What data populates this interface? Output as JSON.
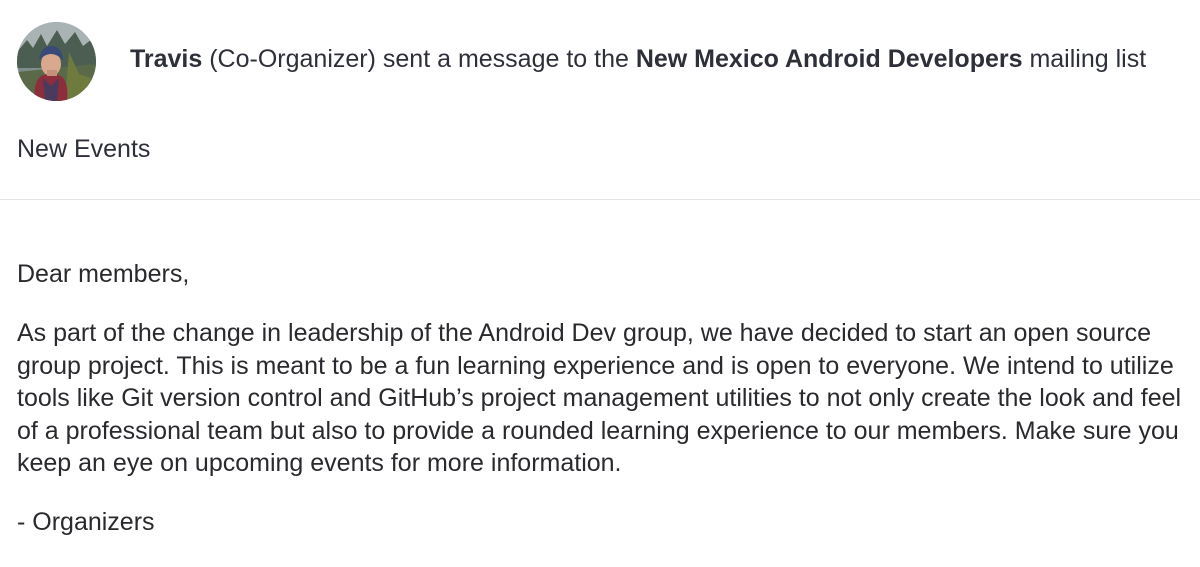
{
  "header": {
    "sender_name": "Travis",
    "sender_role": "(Co-Organizer)",
    "action_text": "sent a message to the",
    "group_name": "New Mexico Android Developers",
    "list_suffix": "mailing list"
  },
  "message": {
    "subject": "New Events",
    "greeting": "Dear members,",
    "body": "As part of the change in leadership of the Android Dev group, we have decided to start an open source group project. This is meant to be a fun learning experience and is open to everyone.  We intend to utilize tools like Git version control and GitHub’s project management utilities to not only create the look and feel of a professional team but also to provide a rounded learning experience to our members. Make sure you keep an eye on upcoming events for more information.",
    "signoff": "- Organizers"
  },
  "colors": {
    "text": "#2e3039",
    "divider": "#e3e3e6",
    "background": "#ffffff"
  }
}
